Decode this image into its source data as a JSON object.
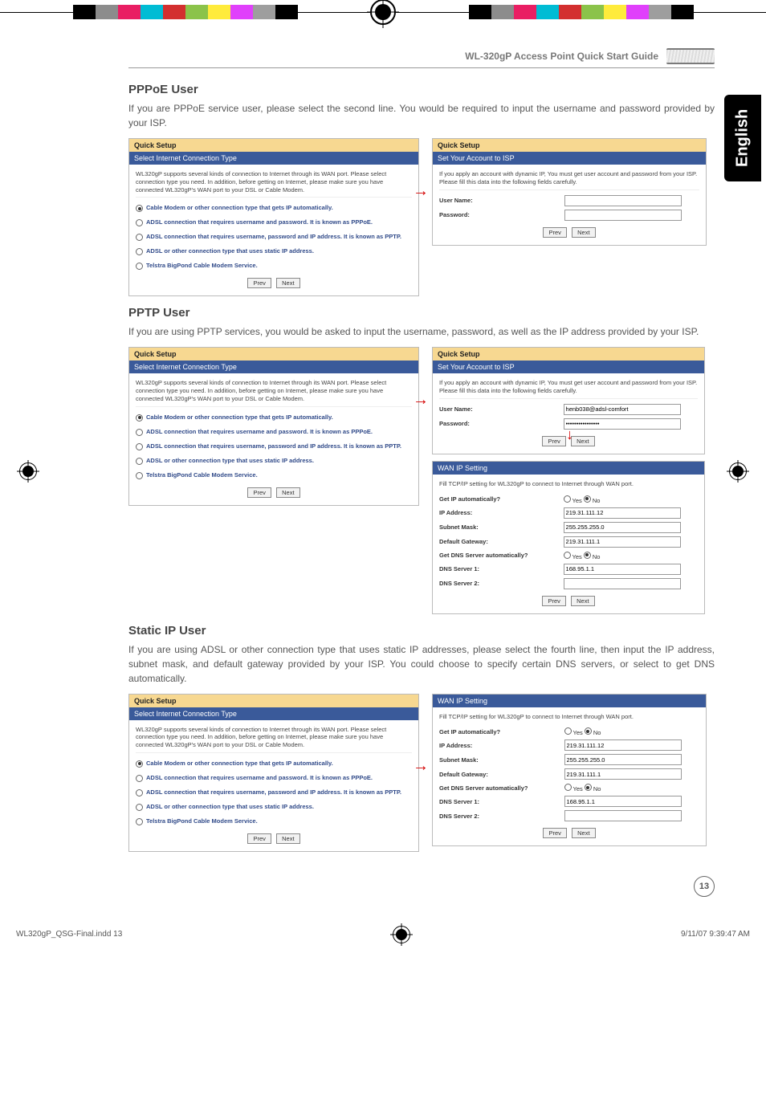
{
  "doc_title": "WL-320gP Access Point Quick Start Guide",
  "language_tab": "English",
  "page_number": "13",
  "footer": {
    "file": "WL320gP_QSG-Final.indd   13",
    "timestamp": "9/11/07   9:39:47 AM"
  },
  "reg_colors": [
    "#000000",
    "#8c8c8c",
    "#e91e63",
    "#00bcd4",
    "#d32f2f",
    "#8bc34a",
    "#ffeb3b",
    "#e040fb",
    "#9e9e9e",
    "#000000"
  ],
  "buttons": {
    "prev": "Prev",
    "next": "Next"
  },
  "quick_setup": {
    "title": "Quick Setup",
    "conn_subtitle": "Select Internet Connection Type",
    "conn_intro": "WL320gP supports several kinds of connection to Internet through its WAN port. Please select connection type you need. In addition, before getting on Internet, please make sure you have connected WL320gP's WAN port to your DSL or Cable Modem.",
    "options": [
      "Cable Modem or other connection type that gets IP automatically.",
      "ADSL connection that requires username and password. It is known as PPPoE.",
      "ADSL connection that requires username, password and IP address. It is known as PPTP.",
      "ADSL or other connection type that uses static IP address.",
      "Telstra BigPond Cable Modem Service."
    ],
    "isp_subtitle": "Set Your Account to ISP",
    "isp_intro": "If you apply an account with dynamic IP, You must get user account and password from your ISP. Please fill this data into the following fields carefully.",
    "isp_user_label": "User Name:",
    "isp_pass_label": "Password:",
    "wan_subtitle": "WAN IP Setting",
    "wan_intro": "Fill TCP/IP setting for WL320gP to connect to Internet through WAN port.",
    "wan_fields": {
      "get_ip": "Get IP automatically?",
      "ip": "IP Address:",
      "mask": "Subnet Mask:",
      "gw": "Default Gateway:",
      "get_dns": "Get DNS Server automatically?",
      "dns1": "DNS Server 1:",
      "dns2": "DNS Server 2:"
    },
    "yes": "Yes",
    "no": "No"
  },
  "sections": {
    "pppoe": {
      "heading": "PPPoE User",
      "body": "If you are PPPoE service user, please select the second line. You would be required to input the username and password provided by your ISP.",
      "selected": 0,
      "isp_user": "",
      "isp_pass": ""
    },
    "pptp": {
      "heading": "PPTP User",
      "body": "If you are using PPTP services, you would be asked to input the username, password, as well as the IP address provided by your ISP.",
      "selected": 0,
      "isp_user": "henb038@adsl-comfort",
      "isp_pass": "••••••••••••••••",
      "wan": {
        "get_ip_yes": false,
        "ip": "219.31.111.12",
        "mask": "255.255.255.0",
        "gw": "219.31.111.1",
        "get_dns_yes": false,
        "dns1": "168.95.1.1",
        "dns2": ""
      }
    },
    "static": {
      "heading": "Static IP User",
      "body": "If you are using ADSL or other connection type that uses static IP addresses, please select the fourth line, then input the IP address, subnet mask, and default gateway provided by your ISP. You could choose to specify certain DNS servers, or select to get DNS automatically.",
      "selected": 0,
      "wan": {
        "get_ip_yes": false,
        "ip": "219.31.111.12",
        "mask": "255.255.255.0",
        "gw": "219.31.111.1",
        "get_dns_yes": false,
        "dns1": "168.95.1.1",
        "dns2": ""
      }
    }
  }
}
